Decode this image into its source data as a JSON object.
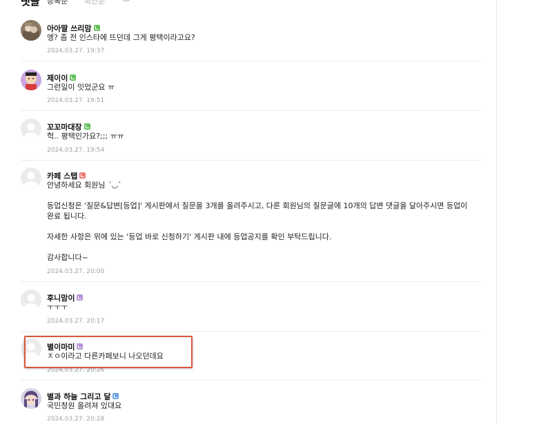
{
  "header": {
    "title": "댓글",
    "sort_registered": "등록순",
    "sort_newest": "최신순",
    "refresh_icon": "refresh-icon"
  },
  "comments": [
    {
      "nickname": "아아딸 쓰리맘",
      "level_color": "#64c05b",
      "lines": [
        "엥? 좀 전 인스타에 뜨던데 그게 평택이라고요?"
      ],
      "date": "2024.03.27. 19:37"
    },
    {
      "nickname": "제이이",
      "level_color": "#64c05b",
      "lines": [
        "그런일이 잇었군요 ㅠ"
      ],
      "date": "2024.03.27. 19:51"
    },
    {
      "nickname": "꼬꼬마대장",
      "level_color": "#64c05b",
      "lines": [
        "헉.. 평택인가요?;;; ㅠㅠ"
      ],
      "date": "2024.03.27. 19:54"
    },
    {
      "nickname": "카페 스탭",
      "level_color": "#e77b74",
      "lines": [
        "안녕하세요 회원님 ´◡`",
        "등업신청은 '질문&답변[등업]' 게시판에서 질문을 3개를 올려주시고, 다른 회원님의 질문글에 10개의 답변 댓글을 달아주시면 등업이 완료 됩니다.",
        "자세한 사항은 위에 있는 '등업 바로 신청하기' 게시판 내에 등업공지를 확인 부탁드립니다.",
        "감사합니다~"
      ],
      "date": "2024.03.27. 20:00"
    },
    {
      "nickname": "후니맘이",
      "level_color": "#b794d9",
      "lines": [
        "ㅜㅜㅜ"
      ],
      "date": "2024.03.27. 20:17"
    },
    {
      "nickname": "별이마미",
      "level_color": "#b794d9",
      "lines": [
        "ㅈㅇ이라고 다른카페보니 나오던데요"
      ],
      "date": "2024.03.27. 20:26"
    },
    {
      "nickname": "별과 하늘 그리고 달",
      "level_color": "#6fa4e6",
      "lines": [
        "국민청원 올려져 있대요"
      ],
      "date": "2024.03.27. 20:28"
    }
  ],
  "highlight_color": "#d8563a"
}
